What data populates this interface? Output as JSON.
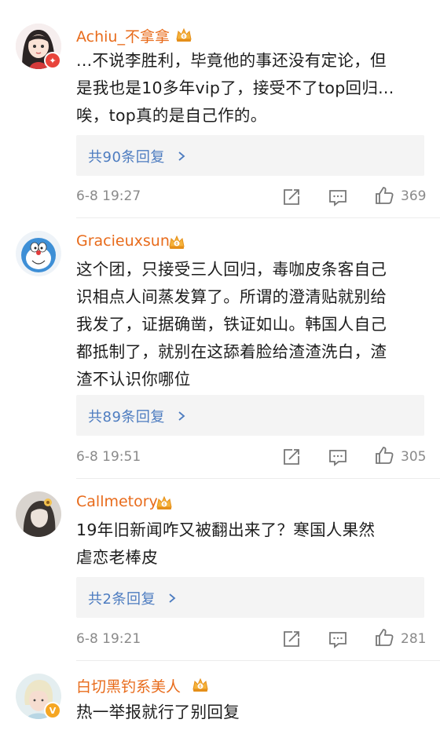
{
  "comments": [
    {
      "username": "Achiu_不拿拿",
      "lines": [
        "...不说李胜利，毕竟他的事还没有定论，但",
        "是我也是10多年vip了，接受不了top回归...",
        "唉，top真的是自己作的。"
      ],
      "replies_label": "共90条回复",
      "time": "6-8 19:27",
      "likes": "369",
      "avatar_badge": "flame-badge-icon"
    },
    {
      "username": "Gracieuxsun",
      "lines": [
        "这个团，只接受三人回归，毒咖皮条客自己",
        "识相点人间蒸发算了。所谓的澄清贴就别给",
        "我发了，证据确凿，铁证如山。韩国人自己",
        "都抵制了，就别在这舔着脸给渣渣洗白，渣",
        "渣不认识你哪位"
      ],
      "replies_label": "共89条回复",
      "time": "6-8 19:51",
      "likes": "305"
    },
    {
      "username": "Callmetory",
      "lines": [
        "19年旧新闻咋又被翻出来了？寒国人果然",
        "虐恋老棒皮"
      ],
      "replies_label": "共2条回复",
      "time": "6-8 19:21",
      "likes": "281"
    },
    {
      "username": "白切黑钓系美人",
      "lines": [
        "热一举报就行了别回复"
      ],
      "avatar_badge": "verified-v-badge-icon"
    }
  ],
  "colors": {
    "username": "#e86b1b",
    "reply_link": "#4d7cc0",
    "meta": "#8a8a8a",
    "reply_bg": "#f4f4f4"
  }
}
